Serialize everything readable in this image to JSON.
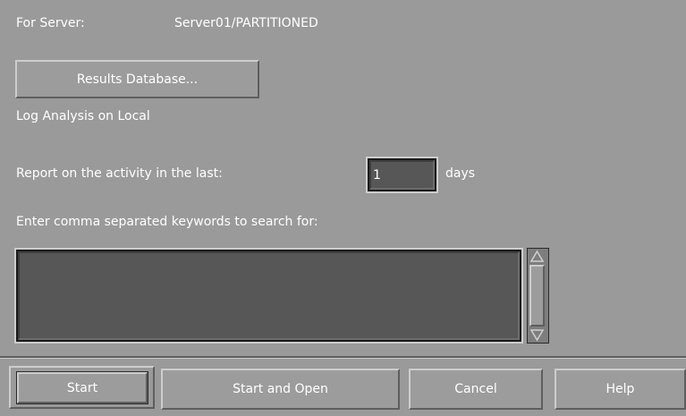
{
  "server": {
    "label": "For Server:",
    "value": "Server01/PARTITIONED"
  },
  "results_database_label": "Results Database...",
  "log_analysis_text": "Log Analysis on Local",
  "report": {
    "label": "Report on the activity in the last:",
    "days_value": "1",
    "unit": "days"
  },
  "keywords": {
    "label": "Enter comma separated keywords to search for:",
    "value": ""
  },
  "scrollbar": {
    "up_icon": "scroll-up-arrow",
    "down_icon": "scroll-down-arrow"
  },
  "buttons": {
    "start": "Start",
    "start_and_open": "Start and Open",
    "cancel": "Cancel",
    "help": "Help"
  }
}
